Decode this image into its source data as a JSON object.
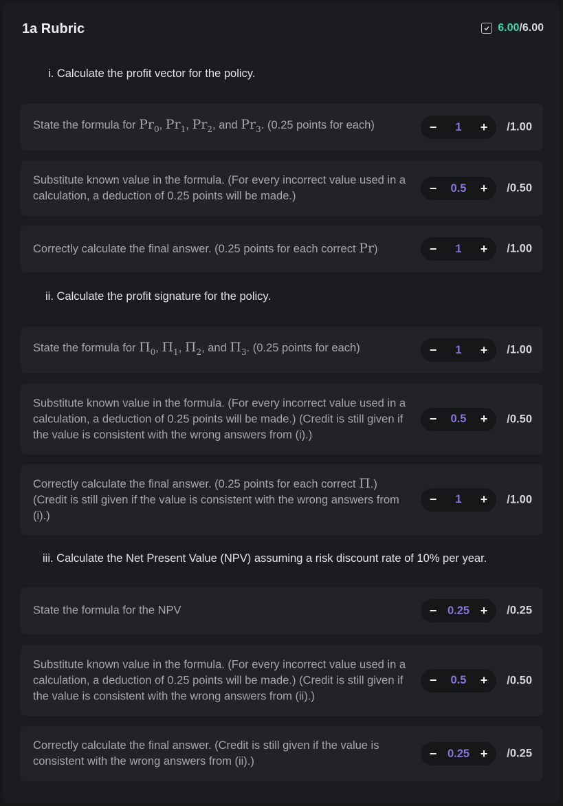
{
  "header": {
    "title": "1a Rubric",
    "score_got": "6.00",
    "score_total": "/6.00"
  },
  "sections": [
    {
      "title": "i. Calculate the profit vector for the policy."
    },
    {
      "title": "ii. Calculate the profit signature for the policy."
    },
    {
      "title": "iii. Calculate the Net Present Value (NPV) assuming a risk discount rate of 10% per year."
    }
  ],
  "items": [
    {
      "pre": "State the formula for ",
      "math": [
        "Pr0",
        "Pr1",
        "Pr2",
        "Pr3"
      ],
      "post": ". (0.25 points for each)",
      "value": "1",
      "max": "/1.00"
    },
    {
      "text": "Substitute known value in the formula. (For every incorrect value used in a calculation, a deduction of 0.25 points will be made.)",
      "value": "0.5",
      "max": "/0.50"
    },
    {
      "pre": "Correctly calculate the final answer. (0.25 points for each correct ",
      "sym": "Pr",
      "post": ")",
      "value": "1",
      "max": "/1.00"
    },
    {
      "pre": "State the formula for ",
      "math": [
        "Π0",
        "Π1",
        "Π2",
        "Π3"
      ],
      "post": ". (0.25 points for each)",
      "value": "1",
      "max": "/1.00"
    },
    {
      "text": "Substitute known value in the formula. (For every incorrect value used in a calculation, a deduction of 0.25 points will be made.) (Credit is still given if the value is consistent with the wrong answers from (i).)",
      "value": "0.5",
      "max": "/0.50"
    },
    {
      "pre": "Correctly calculate the final answer. (0.25 points for each correct ",
      "sym": "Π",
      "post": ".) (Credit is still given if the value is consistent with the wrong answers from (i).)",
      "value": "1",
      "max": "/1.00"
    },
    {
      "text": "State the formula for the NPV",
      "value": "0.25",
      "max": "/0.25"
    },
    {
      "text": "Substitute known value in the formula. (For every incorrect value used in a calculation, a deduction of 0.25 points will be made.) (Credit is still given if the value is consistent with the wrong answers from (ii).)",
      "value": "0.5",
      "max": "/0.50"
    },
    {
      "text": "Correctly calculate the final answer. (Credit is still given if the value is consistent with the wrong answers from (ii).)",
      "value": "0.25",
      "max": "/0.25"
    }
  ],
  "stepper": {
    "minus": "−",
    "plus": "+"
  }
}
